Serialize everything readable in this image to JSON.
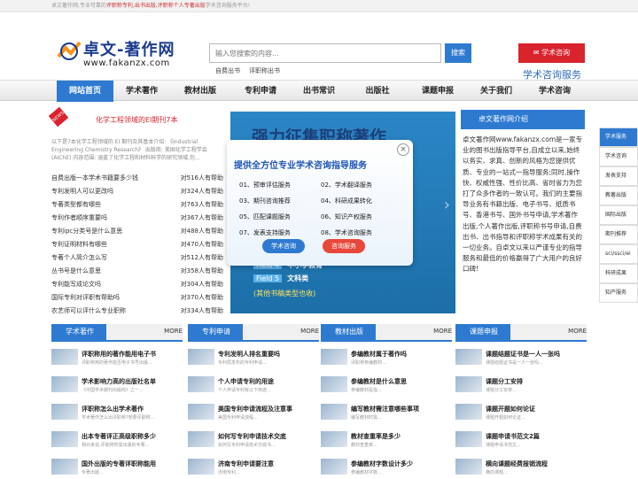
{
  "topbar": {
    "text": "卓文著作网,专业可靠的",
    "hl": "评职称专利,出书出版,评职称个人专著出版",
    "tail": "学术咨询服务平台!"
  },
  "logo": {
    "name": "卓文-著作网",
    "url": "www.fakanzx.com"
  },
  "search": {
    "placeholder": "输入您搜索的内容...",
    "button": "搜索",
    "hot": [
      "自费出书",
      "评职称出书"
    ]
  },
  "consult": {
    "button": "学术咨询",
    "sub": "学术咨询服务"
  },
  "nav": [
    "网站首页",
    "学术著作",
    "教材出版",
    "专利申请",
    "出书常识",
    "出版社",
    "课题申报",
    "关于我们",
    "学术咨询"
  ],
  "left": {
    "badge": "NEWS",
    "feature": "化学工程领域的EI期刊7本",
    "excerpt": "以下是7本化学工程领域的 EI 期刊及其基本介绍: 《Industrial Engineering Chemistry Research》 出版商: 美国化学工程学会(AIChE) 内容范围: 涵盖了化学工程和材料科学的研究领域,包...",
    "rows": [
      [
        "自费出版一本学术书籍要多少钱",
        "对516人有帮助"
      ],
      [
        "专利发明人可以更改吗",
        "对324人有帮助"
      ],
      [
        "专著类型都有哪些",
        "对763人有帮助"
      ],
      [
        "专利作者顺序重要吗",
        "对367人有帮助"
      ],
      [
        "专利ipc分类号是什么意思",
        "对488人有帮助"
      ],
      [
        "专利证明材料有哪些",
        "对470人有帮助"
      ],
      [
        "专著个人简介怎么写",
        "对512人有帮助"
      ],
      [
        "丛书号是什么意思",
        "对358人有帮助"
      ],
      [
        "专利能写成论文吗",
        "对304人有帮助"
      ],
      [
        "国际专利对评职有帮助吗",
        "对370人有帮助"
      ],
      [
        "农艺师可以评什么专业职称",
        "对334人有帮助"
      ]
    ]
  },
  "banner": {
    "headline": "强力征集职称著作",
    "fields": [
      [
        "Field 4",
        "中小学教育"
      ],
      [
        "Field 5",
        "文科类"
      ]
    ],
    "note": "(其他书稿类型也收)"
  },
  "popup": {
    "title": "提供全方位专业学术咨询指导服务",
    "items": [
      "01、预审评估服务",
      "02、学术翻译服务",
      "03、期刊咨询推荐",
      "04、科研成果转化",
      "05、匹配课题服务",
      "06、知识产权服务",
      "07、发表支持服务",
      "08、学术咨询服务"
    ],
    "btn1": "学术咨询",
    "btn2": "咨询服务"
  },
  "intro": {
    "title": "卓文著作网介绍",
    "text": "卓文著作网www.fakanzx.com是一家专业的图书出版指导平台,自成立以来,始终以务实、求真、创新的风格为您提供优质、专业的一站式一指导服务;同时,操作快、权威性强、性价比高、省时省力为您打了众多作者的一致认可。我们的主要指导业务有书籍出版、电子书号、纸质书号、香港书号、国外书号申请,学术著作出版,个人著作出版,评职称书号申请,自费出书、出书指导和评职称学术成果有关的一切业务。自卓文以来以严谨专业的指导服务和最低的价格赢得了广大用户的良好口碑!"
  },
  "side": [
    "学术服务",
    "学术咨询",
    "发表支持",
    "教著出版",
    "国际出版",
    "期刊推荐",
    "sci/ssci/ei",
    "科研成果",
    "知产服务"
  ],
  "sections": [
    {
      "title": "学术著作",
      "more": "MORE",
      "items": [
        [
          "评职称用的著作能用电子书",
          "评职称用的著作能否电子书号出版..."
        ],
        [
          "学术影响力高的出版社名单",
          "《中国学术期刊出版商》之一..."
        ],
        [
          "评职称怎么出学术著作",
          "学术著作怎么出评职称?想要评职称..."
        ],
        [
          "出本专著评正高级职称多少",
          "相对来说,评职称所需出版的专著..."
        ],
        [
          "国外出版的专著评职称能用",
          "专著出版..."
        ]
      ]
    },
    {
      "title": "专利申请",
      "more": "MORE",
      "items": [
        [
          "专利发明人排名重要吗",
          "专利局发布的专利申请..."
        ],
        [
          "个人申请专利的用途",
          "个人申请专利有以下用途..."
        ],
        [
          "美国专利申请流程及注意事",
          "美国专利申请流程..."
        ],
        [
          "如何写专利申请技术交底",
          "如何写专利申请技术交底书..."
        ],
        [
          "济南专利申请要注意",
          "济南专利..."
        ]
      ]
    },
    {
      "title": "教材出版",
      "more": "MORE",
      "items": [
        [
          "参编教材属于著作吗",
          "评职称参编教材..."
        ],
        [
          "参编教材是什么意思",
          "参编教材是指..."
        ],
        [
          "编写教材需注意哪些事项",
          "编写教材时需..."
        ],
        [
          "教材查重率是多少",
          "教材查重率..."
        ],
        [
          "参编教材字数设计多少",
          "参编教材字数..."
        ]
      ]
    },
    {
      "title": "课题申报",
      "more": "MORE",
      "items": [
        [
          "课题结题证书是一人一张吗",
          "课题结题证书是一人一张吗..."
        ],
        [
          "课题分工安排",
          "课题分工安排..."
        ],
        [
          "课题开题如何论证",
          "课题开题如何论证..."
        ],
        [
          "课题申请书范文2篇",
          "课题申请书范文..."
        ],
        [
          "横向课题经费报销流程",
          "横向课题..."
        ]
      ]
    }
  ]
}
